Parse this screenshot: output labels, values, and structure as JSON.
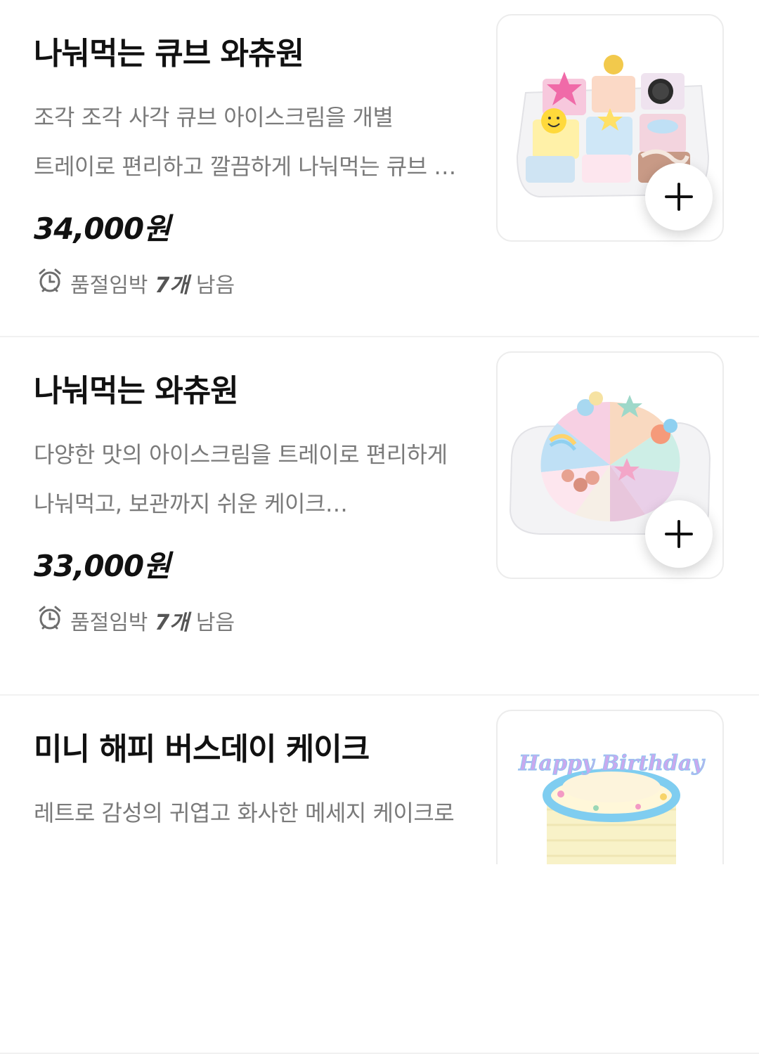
{
  "products": [
    {
      "name": "나눠먹는 큐브 와츄원",
      "desc_line1": "조각 조각 사각 큐브 아이스크림을 개별",
      "desc_line2": "트레이로 편리하고 깔끔하게 나눠먹는 큐브 …",
      "price": "34,000원",
      "stock_label": "품절임박",
      "stock_count": "7개",
      "stock_suffix": "남음",
      "image_icon": "cube-icecream-cake-image"
    },
    {
      "name": "나눠먹는 와츄원",
      "desc_line1": "다양한 맛의 아이스크림을 트레이로 편리하게",
      "desc_line2": "나눠먹고, 보관까지 쉬운 케이크…",
      "price": "33,000원",
      "stock_label": "품절임박",
      "stock_count": "7개",
      "stock_suffix": "남음",
      "image_icon": "round-icecream-cake-image"
    },
    {
      "name": "미니 해피 버스데이 케이크",
      "desc_line1": "레트로 감성의 귀엽고 화사한 메세지 케이크로",
      "image_icon": "birthday-cake-image",
      "image_text": "Happy Birthday"
    }
  ],
  "colors": {
    "title": "#111111",
    "description": "#7a7a7a",
    "divider": "#f1f1f1"
  }
}
